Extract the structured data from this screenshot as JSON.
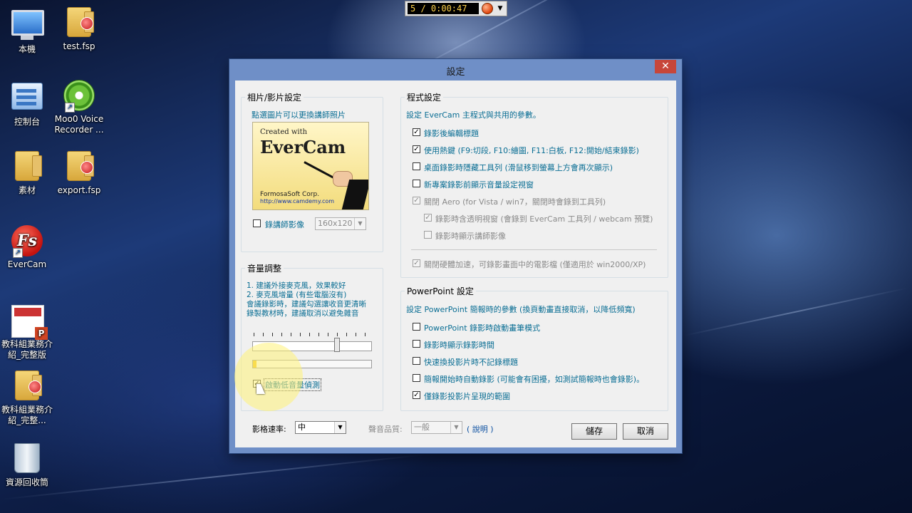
{
  "desktop": {
    "icons": [
      {
        "label": "本機"
      },
      {
        "label": "test.fsp"
      },
      {
        "label": "控制台"
      },
      {
        "label": "Moo0 Voice Recorder ..."
      },
      {
        "label": "素材"
      },
      {
        "label": "export.fsp"
      },
      {
        "label": "EverCam"
      },
      {
        "label": "教科組業務介紹_完整版"
      },
      {
        "label": "教科組業務介紹_完整..."
      },
      {
        "label": "資源回收筒"
      }
    ]
  },
  "recorder": {
    "time": "5 / 0:00:47",
    "menu_arrow": "▼"
  },
  "dialog": {
    "title": "設定",
    "close": "✕",
    "photo": {
      "legend": "相片/影片設定",
      "hint": "點選圖片可以更換講師照片",
      "logo": {
        "created_with": "Created with",
        "brand": "EverCam",
        "corp": "FormosaSoft Corp.",
        "url": "http://www.camdemy.com"
      },
      "record_cam_label": "錄講師影像",
      "resolution": "160x120"
    },
    "volume": {
      "legend": "音量調整",
      "notes": [
        "1. 建議外接麥克風，效果較好",
        "2. 麥克風增量 (有些電腦沒有)",
        "會議錄影時，建議勾選讓收音更清晰",
        "錄製教材時，建議取消以避免雜音"
      ],
      "slider_level": 0.72,
      "meter_level": 0.03,
      "low_volume_label": "啟動低音量偵測",
      "low_volume_checked": true
    },
    "program": {
      "legend": "程式設定",
      "intro": "設定 EverCam 主程式與共用的參數。",
      "options": [
        {
          "label": "錄影後編輯標題",
          "checked": true,
          "enabled": true
        },
        {
          "label": "使用熱鍵 (F9:切段, F10:繪圖, F11:白板, F12:開始/結束錄影)",
          "checked": true,
          "enabled": true
        },
        {
          "label": "桌面錄影時隱藏工具列 (滑鼠移到螢幕上方會再次顯示)",
          "checked": false,
          "enabled": true
        },
        {
          "label": "新專案錄影前顯示音量設定視窗",
          "checked": false,
          "enabled": true
        },
        {
          "label": "關閉 Aero (for Vista / win7，關閉時會錄到工具列)",
          "checked": true,
          "enabled": false
        },
        {
          "label": "錄影時含透明視窗 (會錄到 EverCam 工具列 / webcam 預覽)",
          "checked": true,
          "enabled": false
        },
        {
          "label": "錄影時顯示講師影像",
          "checked": false,
          "enabled": false
        },
        {
          "label": "關閉硬體加速，可錄影畫面中的電影檔 (僅適用於 win2000/XP)",
          "checked": true,
          "enabled": false
        }
      ]
    },
    "powerpoint": {
      "legend": "PowerPoint 設定",
      "intro": "設定 PowerPoint 簡報時的參數 (換頁動畫直接取消，以降低頻寬)",
      "options": [
        {
          "label": "PowerPoint 錄影時啟動畫筆模式",
          "checked": false
        },
        {
          "label": "錄影時顯示錄影時間",
          "checked": false
        },
        {
          "label": "快速換投影片時不記錄標題",
          "checked": false
        },
        {
          "label": "簡報開始時自動錄影 (可能會有困擾，如測試簡報時也會錄影)。",
          "checked": false
        },
        {
          "label": "僅錄影投影片呈現的範圍",
          "checked": true
        }
      ]
    },
    "bottom": {
      "fps_label": "影格速率:",
      "fps_value": "中",
      "audio_label": "聲音品質:",
      "audio_value": "一般",
      "help_link": "( 說明 )",
      "save": "儲存",
      "cancel": "取消"
    }
  }
}
